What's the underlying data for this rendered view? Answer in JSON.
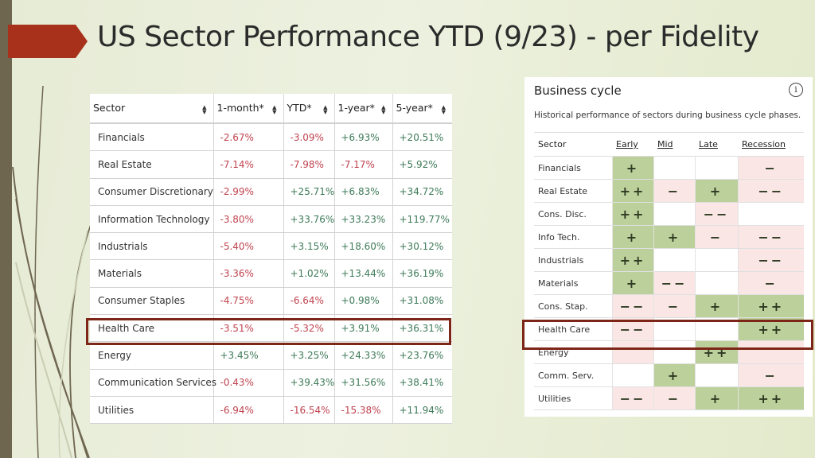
{
  "slide": {
    "title": "US Sector Performance YTD (9/23) - per Fidelity",
    "accent_color": "#a8311c",
    "highlight_color": "#7d2617",
    "highlighted_sector": "Health Care"
  },
  "performance_table": {
    "headers": [
      "Sector",
      "1-month*",
      "YTD*",
      "1-year*",
      "5-year*"
    ],
    "sort_icon": "sort-updown-icon",
    "rows": [
      {
        "sector": "Financials",
        "values": [
          "-2.67%",
          "-3.09%",
          "+6.93%",
          "+20.51%"
        ]
      },
      {
        "sector": "Real Estate",
        "values": [
          "-7.14%",
          "-7.98%",
          "-7.17%",
          "+5.92%"
        ]
      },
      {
        "sector": "Consumer Discretionary",
        "values": [
          "-2.99%",
          "+25.71%",
          "+6.83%",
          "+34.72%"
        ]
      },
      {
        "sector": "Information Technology",
        "values": [
          "-3.80%",
          "+33.76%",
          "+33.23%",
          "+119.77%"
        ]
      },
      {
        "sector": "Industrials",
        "values": [
          "-5.40%",
          "+3.15%",
          "+18.60%",
          "+30.12%"
        ]
      },
      {
        "sector": "Materials",
        "values": [
          "-3.36%",
          "+1.02%",
          "+13.44%",
          "+36.19%"
        ]
      },
      {
        "sector": "Consumer Staples",
        "values": [
          "-4.75%",
          "-6.64%",
          "+0.98%",
          "+31.08%"
        ]
      },
      {
        "sector": "Health Care",
        "values": [
          "-3.51%",
          "-5.32%",
          "+3.91%",
          "+36.31%"
        ]
      },
      {
        "sector": "Energy",
        "values": [
          "+3.45%",
          "+3.25%",
          "+24.33%",
          "+23.76%"
        ]
      },
      {
        "sector": "Communication Services",
        "values": [
          "-0.43%",
          "+39.43%",
          "+31.56%",
          "+38.41%"
        ]
      },
      {
        "sector": "Utilities",
        "values": [
          "-6.94%",
          "-16.54%",
          "-15.38%",
          "+11.94%"
        ]
      }
    ]
  },
  "business_cycle": {
    "title": "Business cycle",
    "info_icon": "info-icon",
    "subtitle": "Historical performance of sectors during business cycle phases.",
    "headers": [
      "Sector",
      "Early",
      "Mid",
      "Late",
      "Recession"
    ],
    "colors": {
      "positive": "#bcd09b",
      "negative": "#fbe6e6",
      "neutral": "#ffffff"
    },
    "rows": [
      {
        "sector": "Financials",
        "cells": [
          {
            "s": "+",
            "t": "g"
          },
          {
            "s": "",
            "t": "w"
          },
          {
            "s": "",
            "t": "w"
          },
          {
            "s": "−",
            "t": "p"
          }
        ]
      },
      {
        "sector": "Real Estate",
        "cells": [
          {
            "s": "++",
            "t": "g"
          },
          {
            "s": "−",
            "t": "p"
          },
          {
            "s": "+",
            "t": "g"
          },
          {
            "s": "−−",
            "t": "p"
          }
        ]
      },
      {
        "sector": "Cons. Disc.",
        "cells": [
          {
            "s": "++",
            "t": "g"
          },
          {
            "s": "",
            "t": "w"
          },
          {
            "s": "−−",
            "t": "p"
          },
          {
            "s": "",
            "t": "w"
          }
        ]
      },
      {
        "sector": "Info Tech.",
        "cells": [
          {
            "s": "+",
            "t": "g"
          },
          {
            "s": "+",
            "t": "g"
          },
          {
            "s": "−",
            "t": "p"
          },
          {
            "s": "−−",
            "t": "p"
          }
        ]
      },
      {
        "sector": "Industrials",
        "cells": [
          {
            "s": "++",
            "t": "g"
          },
          {
            "s": "",
            "t": "w"
          },
          {
            "s": "",
            "t": "w"
          },
          {
            "s": "−−",
            "t": "p"
          }
        ]
      },
      {
        "sector": "Materials",
        "cells": [
          {
            "s": "+",
            "t": "g"
          },
          {
            "s": "−−",
            "t": "p"
          },
          {
            "s": "",
            "t": "w"
          },
          {
            "s": "−",
            "t": "p"
          }
        ]
      },
      {
        "sector": "Cons. Stap.",
        "cells": [
          {
            "s": "−−",
            "t": "p"
          },
          {
            "s": "−",
            "t": "p"
          },
          {
            "s": "+",
            "t": "g"
          },
          {
            "s": "++",
            "t": "g"
          }
        ]
      },
      {
        "sector": "Health Care",
        "cells": [
          {
            "s": "−−",
            "t": "p"
          },
          {
            "s": "",
            "t": "w"
          },
          {
            "s": "",
            "t": "w"
          },
          {
            "s": "++",
            "t": "g"
          }
        ]
      },
      {
        "sector": "Energy",
        "cells": [
          {
            "s": "",
            "t": "p"
          },
          {
            "s": "",
            "t": "w"
          },
          {
            "s": "++",
            "t": "g"
          },
          {
            "s": "",
            "t": "p"
          }
        ]
      },
      {
        "sector": "Comm. Serv.",
        "cells": [
          {
            "s": "",
            "t": "w"
          },
          {
            "s": "+",
            "t": "g"
          },
          {
            "s": "",
            "t": "w"
          },
          {
            "s": "−",
            "t": "p"
          }
        ]
      },
      {
        "sector": "Utilities",
        "cells": [
          {
            "s": "−−",
            "t": "p"
          },
          {
            "s": "−",
            "t": "p"
          },
          {
            "s": "+",
            "t": "g"
          },
          {
            "s": "++",
            "t": "g"
          }
        ]
      }
    ]
  }
}
